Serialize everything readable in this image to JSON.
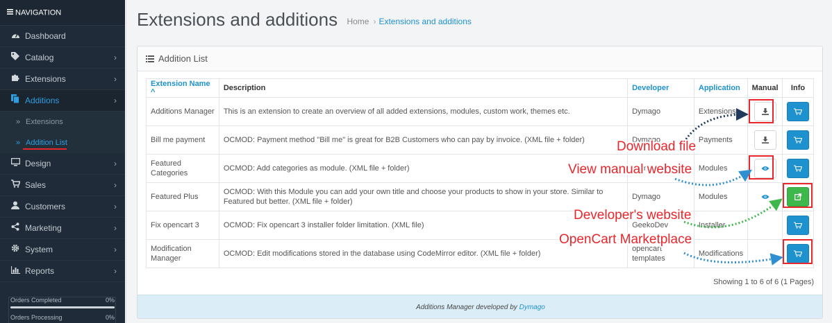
{
  "sidebar": {
    "header": "NAVIGATION",
    "items": [
      {
        "label": "Dashboard",
        "icon": "dashboard-icon",
        "has_children": false
      },
      {
        "label": "Catalog",
        "icon": "tags-icon",
        "has_children": true
      },
      {
        "label": "Extensions",
        "icon": "puzzle-icon",
        "has_children": true
      },
      {
        "label": "Additions",
        "icon": "copy-icon",
        "has_children": true,
        "active": true
      },
      {
        "label": "Design",
        "icon": "monitor-icon",
        "has_children": true
      },
      {
        "label": "Sales",
        "icon": "cart-icon",
        "has_children": true
      },
      {
        "label": "Customers",
        "icon": "user-icon",
        "has_children": true
      },
      {
        "label": "Marketing",
        "icon": "share-icon",
        "has_children": true
      },
      {
        "label": "System",
        "icon": "gear-icon",
        "has_children": true
      },
      {
        "label": "Reports",
        "icon": "bar-chart-icon",
        "has_children": true
      }
    ],
    "sub_items": [
      {
        "label": "Extensions"
      },
      {
        "label": "Addition List",
        "active": true
      }
    ],
    "stats": [
      {
        "label": "Orders Completed",
        "value": "0%"
      },
      {
        "label": "Orders Processing",
        "value": "0%"
      }
    ]
  },
  "header": {
    "title": "Extensions and additions",
    "breadcrumb": [
      "Home",
      "Extensions and additions"
    ]
  },
  "panel": {
    "title": "Addition List",
    "columns": {
      "name": "Extension Name",
      "description": "Description",
      "developer": "Developer",
      "application": "Application",
      "manual": "Manual",
      "info": "Info"
    },
    "rows": [
      {
        "name": "Additions Manager",
        "description": "This is an extension to create an overview of all added extensions, modules, custom work, themes etc.",
        "developer": "Dymago",
        "application": "Extensions",
        "manual": "download",
        "info": "cart"
      },
      {
        "name": "Bill me payment",
        "description": "OCMOD: Payment method \"Bill me\" is great for B2B Customers who can pay by invoice. (XML file + folder)",
        "developer": "Dymago",
        "application": "Payments",
        "manual": "download",
        "info": "cart"
      },
      {
        "name": "Featured Categories",
        "description": "OCMOD: Add categories as module. (XML file + folder)",
        "developer": "Dymago",
        "application": "Modules",
        "manual": "view",
        "info": "cart"
      },
      {
        "name": "Featured Plus",
        "description": "OCMOD: With this Module you can add your own title and choose your products to show in your store. Similar to Featured but better. (XML file + folder)",
        "developer": "Dymago",
        "application": "Modules",
        "manual": "view",
        "info": "external"
      },
      {
        "name": "Fix opencart 3",
        "description": "OCMOD: Fix opencart 3 installer folder limitation. (XML file)",
        "developer": "GeekoDev",
        "application": "Installer",
        "manual": "",
        "info": "cart"
      },
      {
        "name": "Modification Manager",
        "description": "OCMOD: Edit modifications stored in the database using CodeMirror editor. (XML file + folder)",
        "developer": "opencart templates",
        "application": "Modifications",
        "manual": "",
        "info": "cart"
      }
    ],
    "showing": "Showing 1 to 6 of 6 (1 Pages)",
    "footer_text": "Additions Manager developed by",
    "footer_dev": "Dymago"
  },
  "annotations": {
    "download": "Download file",
    "view_manual": "View manual website",
    "developer_site": "Developer's website",
    "marketplace": "OpenCart Marketplace"
  },
  "colors": {
    "sidebar_bg": "#1f2b38",
    "accent": "#1e91cf",
    "success": "#3eb84b",
    "highlight": "#e8262b"
  }
}
